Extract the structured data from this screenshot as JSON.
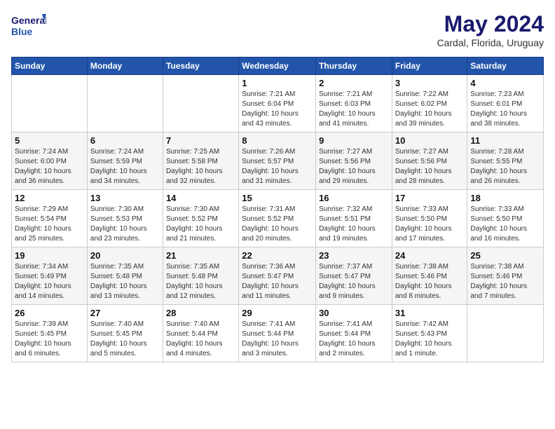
{
  "header": {
    "logo_line1": "General",
    "logo_line2": "Blue",
    "month": "May 2024",
    "location": "Cardal, Florida, Uruguay"
  },
  "weekdays": [
    "Sunday",
    "Monday",
    "Tuesday",
    "Wednesday",
    "Thursday",
    "Friday",
    "Saturday"
  ],
  "weeks": [
    [
      {
        "day": "",
        "info": ""
      },
      {
        "day": "",
        "info": ""
      },
      {
        "day": "",
        "info": ""
      },
      {
        "day": "1",
        "info": "Sunrise: 7:21 AM\nSunset: 6:04 PM\nDaylight: 10 hours\nand 43 minutes."
      },
      {
        "day": "2",
        "info": "Sunrise: 7:21 AM\nSunset: 6:03 PM\nDaylight: 10 hours\nand 41 minutes."
      },
      {
        "day": "3",
        "info": "Sunrise: 7:22 AM\nSunset: 6:02 PM\nDaylight: 10 hours\nand 39 minutes."
      },
      {
        "day": "4",
        "info": "Sunrise: 7:23 AM\nSunset: 6:01 PM\nDaylight: 10 hours\nand 38 minutes."
      }
    ],
    [
      {
        "day": "5",
        "info": "Sunrise: 7:24 AM\nSunset: 6:00 PM\nDaylight: 10 hours\nand 36 minutes."
      },
      {
        "day": "6",
        "info": "Sunrise: 7:24 AM\nSunset: 5:59 PM\nDaylight: 10 hours\nand 34 minutes."
      },
      {
        "day": "7",
        "info": "Sunrise: 7:25 AM\nSunset: 5:58 PM\nDaylight: 10 hours\nand 32 minutes."
      },
      {
        "day": "8",
        "info": "Sunrise: 7:26 AM\nSunset: 5:57 PM\nDaylight: 10 hours\nand 31 minutes."
      },
      {
        "day": "9",
        "info": "Sunrise: 7:27 AM\nSunset: 5:56 PM\nDaylight: 10 hours\nand 29 minutes."
      },
      {
        "day": "10",
        "info": "Sunrise: 7:27 AM\nSunset: 5:56 PM\nDaylight: 10 hours\nand 28 minutes."
      },
      {
        "day": "11",
        "info": "Sunrise: 7:28 AM\nSunset: 5:55 PM\nDaylight: 10 hours\nand 26 minutes."
      }
    ],
    [
      {
        "day": "12",
        "info": "Sunrise: 7:29 AM\nSunset: 5:54 PM\nDaylight: 10 hours\nand 25 minutes."
      },
      {
        "day": "13",
        "info": "Sunrise: 7:30 AM\nSunset: 5:53 PM\nDaylight: 10 hours\nand 23 minutes."
      },
      {
        "day": "14",
        "info": "Sunrise: 7:30 AM\nSunset: 5:52 PM\nDaylight: 10 hours\nand 21 minutes."
      },
      {
        "day": "15",
        "info": "Sunrise: 7:31 AM\nSunset: 5:52 PM\nDaylight: 10 hours\nand 20 minutes."
      },
      {
        "day": "16",
        "info": "Sunrise: 7:32 AM\nSunset: 5:51 PM\nDaylight: 10 hours\nand 19 minutes."
      },
      {
        "day": "17",
        "info": "Sunrise: 7:33 AM\nSunset: 5:50 PM\nDaylight: 10 hours\nand 17 minutes."
      },
      {
        "day": "18",
        "info": "Sunrise: 7:33 AM\nSunset: 5:50 PM\nDaylight: 10 hours\nand 16 minutes."
      }
    ],
    [
      {
        "day": "19",
        "info": "Sunrise: 7:34 AM\nSunset: 5:49 PM\nDaylight: 10 hours\nand 14 minutes."
      },
      {
        "day": "20",
        "info": "Sunrise: 7:35 AM\nSunset: 5:48 PM\nDaylight: 10 hours\nand 13 minutes."
      },
      {
        "day": "21",
        "info": "Sunrise: 7:35 AM\nSunset: 5:48 PM\nDaylight: 10 hours\nand 12 minutes."
      },
      {
        "day": "22",
        "info": "Sunrise: 7:36 AM\nSunset: 5:47 PM\nDaylight: 10 hours\nand 11 minutes."
      },
      {
        "day": "23",
        "info": "Sunrise: 7:37 AM\nSunset: 5:47 PM\nDaylight: 10 hours\nand 9 minutes."
      },
      {
        "day": "24",
        "info": "Sunrise: 7:38 AM\nSunset: 5:46 PM\nDaylight: 10 hours\nand 8 minutes."
      },
      {
        "day": "25",
        "info": "Sunrise: 7:38 AM\nSunset: 5:46 PM\nDaylight: 10 hours\nand 7 minutes."
      }
    ],
    [
      {
        "day": "26",
        "info": "Sunrise: 7:39 AM\nSunset: 5:45 PM\nDaylight: 10 hours\nand 6 minutes."
      },
      {
        "day": "27",
        "info": "Sunrise: 7:40 AM\nSunset: 5:45 PM\nDaylight: 10 hours\nand 5 minutes."
      },
      {
        "day": "28",
        "info": "Sunrise: 7:40 AM\nSunset: 5:44 PM\nDaylight: 10 hours\nand 4 minutes."
      },
      {
        "day": "29",
        "info": "Sunrise: 7:41 AM\nSunset: 5:44 PM\nDaylight: 10 hours\nand 3 minutes."
      },
      {
        "day": "30",
        "info": "Sunrise: 7:41 AM\nSunset: 5:44 PM\nDaylight: 10 hours\nand 2 minutes."
      },
      {
        "day": "31",
        "info": "Sunrise: 7:42 AM\nSunset: 5:43 PM\nDaylight: 10 hours\nand 1 minute."
      },
      {
        "day": "",
        "info": ""
      }
    ]
  ]
}
